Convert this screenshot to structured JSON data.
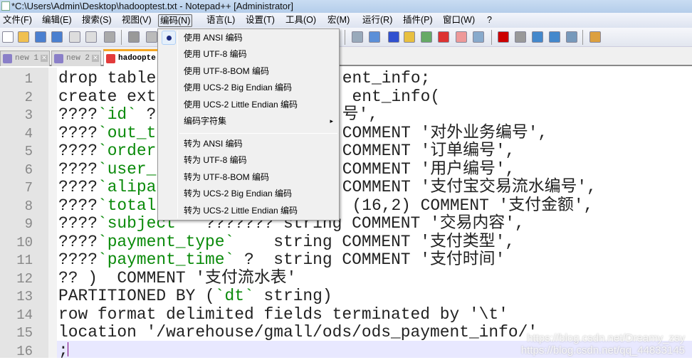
{
  "window": {
    "title": "*C:\\Users\\Admin\\Desktop\\hadooptest.txt - Notepad++ [Administrator]"
  },
  "menubar": [
    "文件(F)",
    "编辑(E)",
    "搜索(S)",
    "视图(V)",
    "编码(N)",
    "语言(L)",
    "设置(T)",
    "工具(O)",
    "宏(M)",
    "运行(R)",
    "插件(P)",
    "窗口(W)",
    "?"
  ],
  "tabs": [
    {
      "label": "new 1",
      "icon": "floppy-disk-icon",
      "color": "#8a7fc8"
    },
    {
      "label": "new 2",
      "icon": "floppy-disk-icon",
      "color": "#8a7fc8"
    },
    {
      "label": "hadoopte",
      "icon": "floppy-disk-icon",
      "color": "#e23b3b"
    }
  ],
  "encoding_menu": {
    "items": [
      {
        "label": "使用 ANSI 编码",
        "checked": true
      },
      {
        "label": "使用 UTF-8 编码"
      },
      {
        "label": "使用 UTF-8-BOM 编码"
      },
      {
        "label": "使用 UCS-2 Big Endian 编码"
      },
      {
        "label": "使用 UCS-2 Little Endian 编码"
      },
      {
        "label": "编码字符集",
        "submenu": true
      },
      {
        "label": "转为 ANSI 编码"
      },
      {
        "label": "转为 UTF-8 编码"
      },
      {
        "label": "转为 UTF-8-BOM 编码"
      },
      {
        "label": "转为 UCS-2 Big Endian 编码"
      },
      {
        "label": "转为 UCS-2 Little Endian 编码"
      }
    ],
    "submenu_arrow": "▸"
  },
  "editor": {
    "lines": [
      {
        "n": "1",
        "left": [
          [
            "drop table",
            ""
          ]
        ],
        "right": [
          [
            "ent_info;",
            ""
          ]
        ]
      },
      {
        "n": "2",
        "left": [
          [
            "create ext",
            ""
          ]
        ],
        "right": [
          [
            "ent_info(",
            ""
          ]
        ]
      },
      {
        "n": "3",
        "left": [
          [
            "????",
            ""
          ],
          [
            "`id`",
            "g"
          ],
          [
            " ?",
            ""
          ]
        ],
        "right": [
          [
            "号',",
            ""
          ]
        ]
      },
      {
        "n": "4",
        "left": [
          [
            "????",
            ""
          ],
          [
            "`out_t",
            "g"
          ]
        ],
        "right": [
          [
            "COMMENT '对外业务编号',",
            ""
          ]
        ]
      },
      {
        "n": "5",
        "left": [
          [
            "????",
            ""
          ],
          [
            "`order",
            "g"
          ]
        ],
        "right": [
          [
            "COMMENT '订单编号',",
            ""
          ]
        ]
      },
      {
        "n": "6",
        "left": [
          [
            "????",
            ""
          ],
          [
            "`user_",
            "g"
          ]
        ],
        "right": [
          [
            "COMMENT '用户编号',",
            ""
          ]
        ]
      },
      {
        "n": "7",
        "left": [
          [
            "????",
            ""
          ],
          [
            "`alipa",
            "g"
          ]
        ],
        "right": [
          [
            "COMMENT '支付宝交易流水编号',",
            ""
          ]
        ]
      },
      {
        "n": "8",
        "left": [
          [
            "????",
            ""
          ],
          [
            "`total",
            "g"
          ]
        ],
        "right": [
          [
            "(16,2) COMMENT '支付金额',",
            ""
          ]
        ]
      },
      {
        "n": "9",
        "left": [
          [
            "????",
            ""
          ],
          [
            "`subject`",
            "g"
          ],
          [
            "  ??????? string COMMENT '交易内容',",
            ""
          ]
        ]
      },
      {
        "n": "10",
        "left": [
          [
            "????",
            ""
          ],
          [
            "`payment_type`",
            "g"
          ],
          [
            "    string COMMENT '支付类型',",
            ""
          ]
        ]
      },
      {
        "n": "11",
        "left": [
          [
            "????",
            ""
          ],
          [
            "`payment_time`",
            "g"
          ],
          [
            " ?  string COMMENT '支付时间'",
            ""
          ]
        ]
      },
      {
        "n": "12",
        "left": [
          [
            "?? )  COMMENT '支付流水表'",
            ""
          ]
        ]
      },
      {
        "n": "13",
        "left": [
          [
            "PARTITIONED BY (",
            ""
          ],
          [
            "`dt`",
            "g"
          ],
          [
            " string)",
            ""
          ]
        ]
      },
      {
        "n": "14",
        "left": [
          [
            "row format delimited fields terminated by '\\t'",
            ""
          ]
        ]
      },
      {
        "n": "15",
        "left": [
          [
            "location '/warehouse/gmall/ods/ods_payment_info/'",
            ""
          ]
        ]
      },
      {
        "n": "16",
        "left": [
          [
            ";",
            ""
          ]
        ]
      }
    ]
  },
  "watermark": [
    "https://blog.csdn.net/Dreamy_zsy",
    "https://blog.csdn.net/qq_44833145"
  ],
  "colors": {
    "identifier": "#0a8a0a",
    "current_line": "#e8e8ff",
    "gutter": "#e4e4e4",
    "active_tab_accent": "#f5a623"
  }
}
